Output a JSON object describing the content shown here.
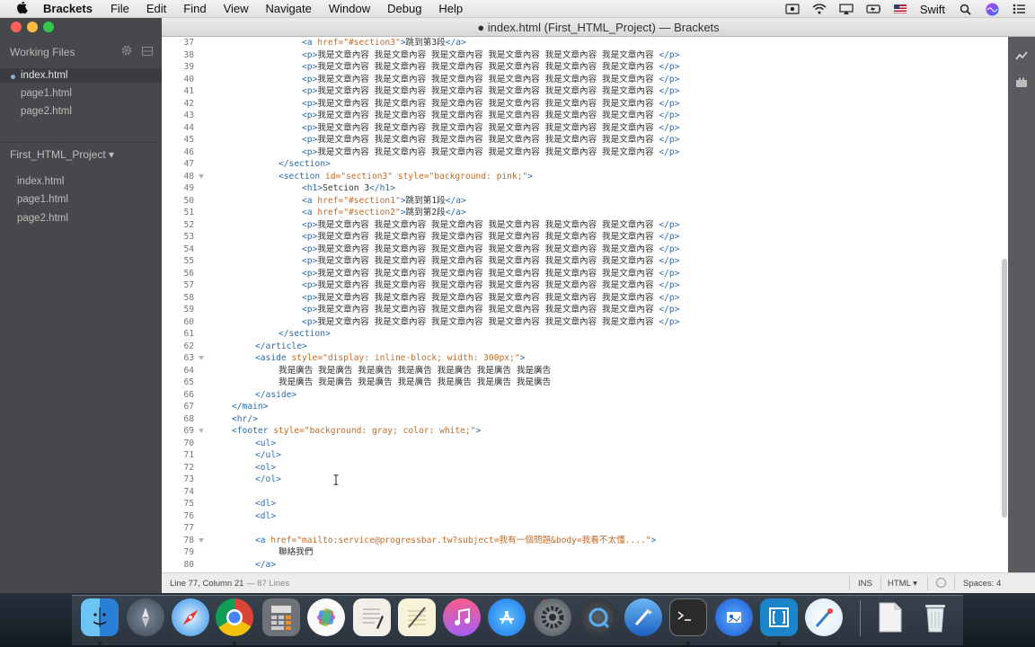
{
  "menubar": {
    "app_name": "Brackets",
    "items": [
      "File",
      "Edit",
      "Find",
      "View",
      "Navigate",
      "Window",
      "Debug",
      "Help"
    ],
    "right_text": "Swift"
  },
  "window": {
    "title": "● index.html (First_HTML_Project) — Brackets"
  },
  "sidebar": {
    "working_files_header": "Working Files",
    "working_files": [
      "index.html",
      "page1.html",
      "page2.html"
    ],
    "project_name": "First_HTML_Project ▾",
    "project_files": [
      "index.html",
      "page1.html",
      "page2.html"
    ]
  },
  "editor": {
    "lines": [
      {
        "n": "37",
        "fold": false,
        "ind": 8,
        "segs": [
          [
            "t",
            "<a "
          ],
          [
            "a",
            "href="
          ],
          [
            "s",
            "\"#section3\""
          ],
          [
            "t",
            ">"
          ],
          [
            "x",
            "跳到第3段"
          ],
          [
            "t",
            "</a>"
          ]
        ]
      },
      {
        "n": "38",
        "fold": false,
        "ind": 8,
        "segs": [
          [
            "t",
            "<p>"
          ],
          [
            "x",
            "我是文章內容 我是文章內容 我是文章內容 我是文章內容 我是文章內容 我是文章內容 "
          ],
          [
            "t",
            "</p>"
          ]
        ]
      },
      {
        "n": "39",
        "fold": false,
        "ind": 8,
        "segs": [
          [
            "t",
            "<p>"
          ],
          [
            "x",
            "我是文章內容 我是文章內容 我是文章內容 我是文章內容 我是文章內容 我是文章內容 "
          ],
          [
            "t",
            "</p>"
          ]
        ]
      },
      {
        "n": "40",
        "fold": false,
        "ind": 8,
        "segs": [
          [
            "t",
            "<p>"
          ],
          [
            "x",
            "我是文章內容 我是文章內容 我是文章內容 我是文章內容 我是文章內容 我是文章內容 "
          ],
          [
            "t",
            "</p>"
          ]
        ]
      },
      {
        "n": "41",
        "fold": false,
        "ind": 8,
        "segs": [
          [
            "t",
            "<p>"
          ],
          [
            "x",
            "我是文章內容 我是文章內容 我是文章內容 我是文章內容 我是文章內容 我是文章內容 "
          ],
          [
            "t",
            "</p>"
          ]
        ]
      },
      {
        "n": "42",
        "fold": false,
        "ind": 8,
        "segs": [
          [
            "t",
            "<p>"
          ],
          [
            "x",
            "我是文章內容 我是文章內容 我是文章內容 我是文章內容 我是文章內容 我是文章內容 "
          ],
          [
            "t",
            "</p>"
          ]
        ]
      },
      {
        "n": "43",
        "fold": false,
        "ind": 8,
        "segs": [
          [
            "t",
            "<p>"
          ],
          [
            "x",
            "我是文章內容 我是文章內容 我是文章內容 我是文章內容 我是文章內容 我是文章內容 "
          ],
          [
            "t",
            "</p>"
          ]
        ]
      },
      {
        "n": "44",
        "fold": false,
        "ind": 8,
        "segs": [
          [
            "t",
            "<p>"
          ],
          [
            "x",
            "我是文章內容 我是文章內容 我是文章內容 我是文章內容 我是文章內容 我是文章內容 "
          ],
          [
            "t",
            "</p>"
          ]
        ]
      },
      {
        "n": "45",
        "fold": false,
        "ind": 8,
        "segs": [
          [
            "t",
            "<p>"
          ],
          [
            "x",
            "我是文章內容 我是文章內容 我是文章內容 我是文章內容 我是文章內容 我是文章內容 "
          ],
          [
            "t",
            "</p>"
          ]
        ]
      },
      {
        "n": "46",
        "fold": false,
        "ind": 8,
        "segs": [
          [
            "t",
            "<p>"
          ],
          [
            "x",
            "我是文章內容 我是文章內容 我是文章內容 我是文章內容 我是文章內容 我是文章內容 "
          ],
          [
            "t",
            "</p>"
          ]
        ]
      },
      {
        "n": "47",
        "fold": false,
        "ind": 6,
        "segs": [
          [
            "t",
            "</section>"
          ]
        ]
      },
      {
        "n": "48",
        "fold": true,
        "ind": 6,
        "segs": [
          [
            "t",
            "<section "
          ],
          [
            "a",
            "id="
          ],
          [
            "s",
            "\"section3\" "
          ],
          [
            "a",
            "style="
          ],
          [
            "s",
            "\"background: pink;\""
          ],
          [
            "t",
            ">"
          ]
        ]
      },
      {
        "n": "49",
        "fold": false,
        "ind": 8,
        "segs": [
          [
            "t",
            "<h1>"
          ],
          [
            "x",
            "Setcion 3"
          ],
          [
            "t",
            "</h1>"
          ]
        ]
      },
      {
        "n": "50",
        "fold": false,
        "ind": 8,
        "segs": [
          [
            "t",
            "<a "
          ],
          [
            "a",
            "href="
          ],
          [
            "s",
            "\"#section1\""
          ],
          [
            "t",
            ">"
          ],
          [
            "x",
            "跳到第1段"
          ],
          [
            "t",
            "</a>"
          ]
        ]
      },
      {
        "n": "51",
        "fold": false,
        "ind": 8,
        "segs": [
          [
            "t",
            "<a "
          ],
          [
            "a",
            "href="
          ],
          [
            "s",
            "\"#section2\""
          ],
          [
            "t",
            ">"
          ],
          [
            "x",
            "跳到第2段"
          ],
          [
            "t",
            "</a>"
          ]
        ]
      },
      {
        "n": "52",
        "fold": false,
        "ind": 8,
        "segs": [
          [
            "t",
            "<p>"
          ],
          [
            "x",
            "我是文章內容 我是文章內容 我是文章內容 我是文章內容 我是文章內容 我是文章內容 "
          ],
          [
            "t",
            "</p>"
          ]
        ]
      },
      {
        "n": "53",
        "fold": false,
        "ind": 8,
        "segs": [
          [
            "t",
            "<p>"
          ],
          [
            "x",
            "我是文章內容 我是文章內容 我是文章內容 我是文章內容 我是文章內容 我是文章內容 "
          ],
          [
            "t",
            "</p>"
          ]
        ]
      },
      {
        "n": "54",
        "fold": false,
        "ind": 8,
        "segs": [
          [
            "t",
            "<p>"
          ],
          [
            "x",
            "我是文章內容 我是文章內容 我是文章內容 我是文章內容 我是文章內容 我是文章內容 "
          ],
          [
            "t",
            "</p>"
          ]
        ]
      },
      {
        "n": "55",
        "fold": false,
        "ind": 8,
        "segs": [
          [
            "t",
            "<p>"
          ],
          [
            "x",
            "我是文章內容 我是文章內容 我是文章內容 我是文章內容 我是文章內容 我是文章內容 "
          ],
          [
            "t",
            "</p>"
          ]
        ]
      },
      {
        "n": "56",
        "fold": false,
        "ind": 8,
        "segs": [
          [
            "t",
            "<p>"
          ],
          [
            "x",
            "我是文章內容 我是文章內容 我是文章內容 我是文章內容 我是文章內容 我是文章內容 "
          ],
          [
            "t",
            "</p>"
          ]
        ]
      },
      {
        "n": "57",
        "fold": false,
        "ind": 8,
        "segs": [
          [
            "t",
            "<p>"
          ],
          [
            "x",
            "我是文章內容 我是文章內容 我是文章內容 我是文章內容 我是文章內容 我是文章內容 "
          ],
          [
            "t",
            "</p>"
          ]
        ]
      },
      {
        "n": "58",
        "fold": false,
        "ind": 8,
        "segs": [
          [
            "t",
            "<p>"
          ],
          [
            "x",
            "我是文章內容 我是文章內容 我是文章內容 我是文章內容 我是文章內容 我是文章內容 "
          ],
          [
            "t",
            "</p>"
          ]
        ]
      },
      {
        "n": "59",
        "fold": false,
        "ind": 8,
        "segs": [
          [
            "t",
            "<p>"
          ],
          [
            "x",
            "我是文章內容 我是文章內容 我是文章內容 我是文章內容 我是文章內容 我是文章內容 "
          ],
          [
            "t",
            "</p>"
          ]
        ]
      },
      {
        "n": "60",
        "fold": false,
        "ind": 8,
        "segs": [
          [
            "t",
            "<p>"
          ],
          [
            "x",
            "我是文章內容 我是文章內容 我是文章內容 我是文章內容 我是文章內容 我是文章內容 "
          ],
          [
            "t",
            "</p>"
          ]
        ]
      },
      {
        "n": "61",
        "fold": false,
        "ind": 6,
        "segs": [
          [
            "t",
            "</section>"
          ]
        ]
      },
      {
        "n": "62",
        "fold": false,
        "ind": 4,
        "segs": [
          [
            "t",
            "</article>"
          ]
        ]
      },
      {
        "n": "63",
        "fold": true,
        "ind": 4,
        "segs": [
          [
            "t",
            "<aside "
          ],
          [
            "a",
            "style="
          ],
          [
            "s",
            "\"display: inline-block; width: 300px;\""
          ],
          [
            "t",
            ">"
          ]
        ]
      },
      {
        "n": "64",
        "fold": false,
        "ind": 6,
        "segs": [
          [
            "x",
            "我是廣告 我是廣告 我是廣告 我是廣告 我是廣告 我是廣告 我是廣告"
          ]
        ]
      },
      {
        "n": "65",
        "fold": false,
        "ind": 6,
        "segs": [
          [
            "x",
            "我是廣告 我是廣告 我是廣告 我是廣告 我是廣告 我是廣告 我是廣告"
          ]
        ]
      },
      {
        "n": "66",
        "fold": false,
        "ind": 4,
        "segs": [
          [
            "t",
            "</aside>"
          ]
        ]
      },
      {
        "n": "67",
        "fold": false,
        "ind": 2,
        "segs": [
          [
            "t",
            "</main>"
          ]
        ]
      },
      {
        "n": "68",
        "fold": false,
        "ind": 2,
        "segs": [
          [
            "t",
            "<hr/>"
          ]
        ]
      },
      {
        "n": "69",
        "fold": true,
        "ind": 2,
        "segs": [
          [
            "t",
            "<footer "
          ],
          [
            "a",
            "style="
          ],
          [
            "s",
            "\"background: gray; color: white;\""
          ],
          [
            "t",
            ">"
          ]
        ]
      },
      {
        "n": "70",
        "fold": false,
        "ind": 4,
        "segs": [
          [
            "t",
            "<ul>"
          ]
        ]
      },
      {
        "n": "71",
        "fold": false,
        "ind": 4,
        "segs": [
          [
            "t",
            "</ul>"
          ]
        ]
      },
      {
        "n": "72",
        "fold": false,
        "ind": 4,
        "segs": [
          [
            "t",
            "<ol>"
          ]
        ]
      },
      {
        "n": "73",
        "fold": false,
        "ind": 4,
        "segs": [
          [
            "t",
            "</ol>"
          ]
        ]
      },
      {
        "n": "74",
        "fold": false,
        "ind": 0,
        "segs": []
      },
      {
        "n": "75",
        "fold": false,
        "ind": 4,
        "segs": [
          [
            "t",
            "<dl>"
          ]
        ]
      },
      {
        "n": "76",
        "fold": false,
        "ind": 4,
        "segs": [
          [
            "t",
            "<dl>"
          ]
        ]
      },
      {
        "n": "77",
        "fold": false,
        "ind": 0,
        "segs": []
      },
      {
        "n": "78",
        "fold": true,
        "ind": 4,
        "segs": [
          [
            "t",
            "<a "
          ],
          [
            "a",
            "href="
          ],
          [
            "s",
            "\"mailto:service@progressbar.tw?subject=我有一個問題&body=我看不太懂....\""
          ],
          [
            "t",
            ">"
          ]
        ]
      },
      {
        "n": "79",
        "fold": false,
        "ind": 6,
        "segs": [
          [
            "x",
            "聯絡我們"
          ]
        ]
      },
      {
        "n": "80",
        "fold": false,
        "ind": 4,
        "segs": [
          [
            "t",
            "</a>"
          ]
        ]
      }
    ]
  },
  "statusbar": {
    "cursor": "Line 77, Column 21",
    "lines": "— 87 Lines",
    "mode": "INS",
    "language": "HTML ▾",
    "spaces": "Spaces: 4"
  },
  "dock": {
    "icons": [
      "finder-icon",
      "launchpad-icon",
      "safari-icon",
      "chrome-icon",
      "calculator-icon",
      "photos-icon",
      "textedit-icon",
      "notes-icon",
      "itunes-icon",
      "app-store-icon",
      "system-preferences-icon",
      "quicktime-icon",
      "xcode-icon",
      "terminal-icon",
      "preview-icon",
      "brackets-icon",
      "color-picker-icon",
      "document-icon",
      "trash-icon"
    ],
    "app_store_badge": "6",
    "colors": {
      "accent": "#2a6bb2",
      "string": "#c26b2a"
    }
  }
}
